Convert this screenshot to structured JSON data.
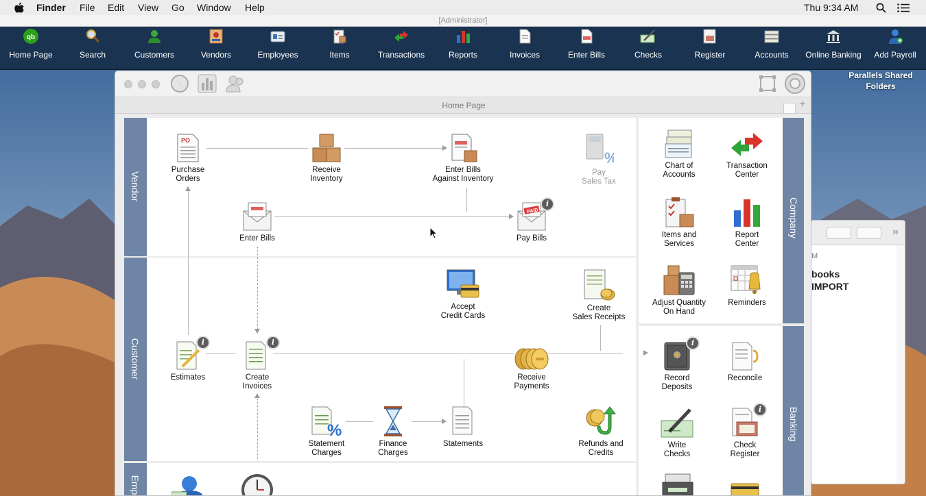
{
  "menubar": {
    "app_name": "Finder",
    "menus": [
      "File",
      "Edit",
      "View",
      "Go",
      "Window",
      "Help"
    ],
    "clock": "Thu 9:34 AM"
  },
  "toolbar": {
    "user_label": "[Administrator]",
    "items": [
      "Home Page",
      "Search",
      "Customers",
      "Vendors",
      "Employees",
      "Items",
      "Transactions",
      "Reports",
      "Invoices",
      "Enter Bills",
      "Checks",
      "Register",
      "Accounts",
      "Online Banking",
      "Add Payroll"
    ]
  },
  "desktop": {
    "shared_folder": [
      "Parallels Shared",
      "Folders"
    ]
  },
  "bg_window": {
    "line1": "M",
    "line2": "books",
    "line3": "IMPORT"
  },
  "window": {
    "tab_title": "Home Page"
  },
  "sections": {
    "vendor": "Vendor",
    "customer": "Customer",
    "employee": "Emp",
    "company": "Company",
    "banking": "Banking"
  },
  "vendor_items": {
    "purchase_orders": [
      "Purchase",
      "Orders"
    ],
    "receive_inventory": [
      "Receive",
      "Inventory"
    ],
    "enter_bills_inventory": [
      "Enter Bills",
      "Against Inventory"
    ],
    "pay_sales_tax": [
      "Pay",
      "Sales Tax"
    ],
    "enter_bills": [
      "Enter Bills"
    ],
    "pay_bills": [
      "Pay Bills"
    ]
  },
  "customer_items": {
    "accept_credit_cards": [
      "Accept",
      "Credit Cards"
    ],
    "create_sales_receipts": [
      "Create",
      "Sales Receipts"
    ],
    "estimates": [
      "Estimates"
    ],
    "create_invoices": [
      "Create",
      "Invoices"
    ],
    "receive_payments": [
      "Receive",
      "Payments"
    ],
    "statement_charges": [
      "Statement",
      "Charges"
    ],
    "finance_charges": [
      "Finance",
      "Charges"
    ],
    "statements": [
      "Statements"
    ],
    "refunds_credits": [
      "Refunds and",
      "Credits"
    ]
  },
  "company_items": {
    "chart_of_accounts": [
      "Chart of",
      "Accounts"
    ],
    "transaction_center": [
      "Transaction",
      "Center"
    ],
    "items_services": [
      "Items and",
      "Services"
    ],
    "report_center": [
      "Report",
      "Center"
    ],
    "adjust_quantity": [
      "Adjust Quantity",
      "On Hand"
    ],
    "reminders": [
      "Reminders"
    ]
  },
  "banking_items": {
    "record_deposits": [
      "Record",
      "Deposits"
    ],
    "reconcile": [
      "Reconcile"
    ],
    "write_checks": [
      "Write",
      "Checks"
    ],
    "check_register": [
      "Check",
      "Register"
    ]
  },
  "info_badge": "i",
  "colors": {
    "toolbar_bg": "#1a3350",
    "section_band": "#6e85a5",
    "menubar_bg": "#ececec"
  }
}
